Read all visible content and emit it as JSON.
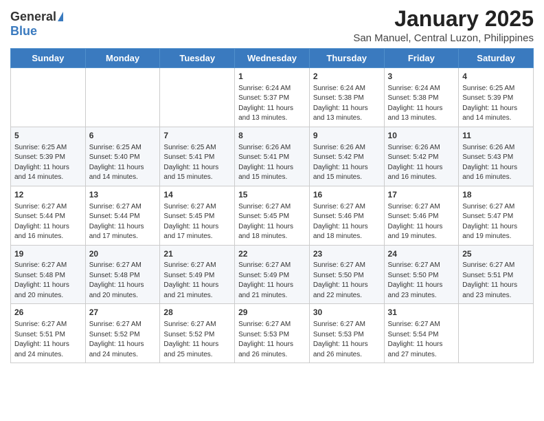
{
  "logo": {
    "general": "General",
    "blue": "Blue"
  },
  "header": {
    "title": "January 2025",
    "subtitle": "San Manuel, Central Luzon, Philippines"
  },
  "days_of_week": [
    "Sunday",
    "Monday",
    "Tuesday",
    "Wednesday",
    "Thursday",
    "Friday",
    "Saturday"
  ],
  "weeks": [
    [
      {
        "day": "",
        "info": ""
      },
      {
        "day": "",
        "info": ""
      },
      {
        "day": "",
        "info": ""
      },
      {
        "day": "1",
        "info": "Sunrise: 6:24 AM\nSunset: 5:37 PM\nDaylight: 11 hours and 13 minutes."
      },
      {
        "day": "2",
        "info": "Sunrise: 6:24 AM\nSunset: 5:38 PM\nDaylight: 11 hours and 13 minutes."
      },
      {
        "day": "3",
        "info": "Sunrise: 6:24 AM\nSunset: 5:38 PM\nDaylight: 11 hours and 13 minutes."
      },
      {
        "day": "4",
        "info": "Sunrise: 6:25 AM\nSunset: 5:39 PM\nDaylight: 11 hours and 14 minutes."
      }
    ],
    [
      {
        "day": "5",
        "info": "Sunrise: 6:25 AM\nSunset: 5:39 PM\nDaylight: 11 hours and 14 minutes."
      },
      {
        "day": "6",
        "info": "Sunrise: 6:25 AM\nSunset: 5:40 PM\nDaylight: 11 hours and 14 minutes."
      },
      {
        "day": "7",
        "info": "Sunrise: 6:25 AM\nSunset: 5:41 PM\nDaylight: 11 hours and 15 minutes."
      },
      {
        "day": "8",
        "info": "Sunrise: 6:26 AM\nSunset: 5:41 PM\nDaylight: 11 hours and 15 minutes."
      },
      {
        "day": "9",
        "info": "Sunrise: 6:26 AM\nSunset: 5:42 PM\nDaylight: 11 hours and 15 minutes."
      },
      {
        "day": "10",
        "info": "Sunrise: 6:26 AM\nSunset: 5:42 PM\nDaylight: 11 hours and 16 minutes."
      },
      {
        "day": "11",
        "info": "Sunrise: 6:26 AM\nSunset: 5:43 PM\nDaylight: 11 hours and 16 minutes."
      }
    ],
    [
      {
        "day": "12",
        "info": "Sunrise: 6:27 AM\nSunset: 5:44 PM\nDaylight: 11 hours and 16 minutes."
      },
      {
        "day": "13",
        "info": "Sunrise: 6:27 AM\nSunset: 5:44 PM\nDaylight: 11 hours and 17 minutes."
      },
      {
        "day": "14",
        "info": "Sunrise: 6:27 AM\nSunset: 5:45 PM\nDaylight: 11 hours and 17 minutes."
      },
      {
        "day": "15",
        "info": "Sunrise: 6:27 AM\nSunset: 5:45 PM\nDaylight: 11 hours and 18 minutes."
      },
      {
        "day": "16",
        "info": "Sunrise: 6:27 AM\nSunset: 5:46 PM\nDaylight: 11 hours and 18 minutes."
      },
      {
        "day": "17",
        "info": "Sunrise: 6:27 AM\nSunset: 5:46 PM\nDaylight: 11 hours and 19 minutes."
      },
      {
        "day": "18",
        "info": "Sunrise: 6:27 AM\nSunset: 5:47 PM\nDaylight: 11 hours and 19 minutes."
      }
    ],
    [
      {
        "day": "19",
        "info": "Sunrise: 6:27 AM\nSunset: 5:48 PM\nDaylight: 11 hours and 20 minutes."
      },
      {
        "day": "20",
        "info": "Sunrise: 6:27 AM\nSunset: 5:48 PM\nDaylight: 11 hours and 20 minutes."
      },
      {
        "day": "21",
        "info": "Sunrise: 6:27 AM\nSunset: 5:49 PM\nDaylight: 11 hours and 21 minutes."
      },
      {
        "day": "22",
        "info": "Sunrise: 6:27 AM\nSunset: 5:49 PM\nDaylight: 11 hours and 21 minutes."
      },
      {
        "day": "23",
        "info": "Sunrise: 6:27 AM\nSunset: 5:50 PM\nDaylight: 11 hours and 22 minutes."
      },
      {
        "day": "24",
        "info": "Sunrise: 6:27 AM\nSunset: 5:50 PM\nDaylight: 11 hours and 23 minutes."
      },
      {
        "day": "25",
        "info": "Sunrise: 6:27 AM\nSunset: 5:51 PM\nDaylight: 11 hours and 23 minutes."
      }
    ],
    [
      {
        "day": "26",
        "info": "Sunrise: 6:27 AM\nSunset: 5:51 PM\nDaylight: 11 hours and 24 minutes."
      },
      {
        "day": "27",
        "info": "Sunrise: 6:27 AM\nSunset: 5:52 PM\nDaylight: 11 hours and 24 minutes."
      },
      {
        "day": "28",
        "info": "Sunrise: 6:27 AM\nSunset: 5:52 PM\nDaylight: 11 hours and 25 minutes."
      },
      {
        "day": "29",
        "info": "Sunrise: 6:27 AM\nSunset: 5:53 PM\nDaylight: 11 hours and 26 minutes."
      },
      {
        "day": "30",
        "info": "Sunrise: 6:27 AM\nSunset: 5:53 PM\nDaylight: 11 hours and 26 minutes."
      },
      {
        "day": "31",
        "info": "Sunrise: 6:27 AM\nSunset: 5:54 PM\nDaylight: 11 hours and 27 minutes."
      },
      {
        "day": "",
        "info": ""
      }
    ]
  ]
}
